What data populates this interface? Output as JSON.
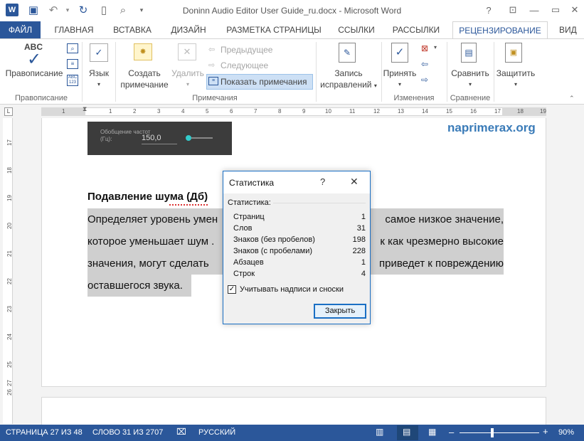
{
  "window": {
    "title": "Doninn Audio Editor User Guide_ru.docx - Microsoft Word",
    "help": "?"
  },
  "tabs": [
    "ФАЙЛ",
    "ГЛАВНАЯ",
    "ВСТАВКА",
    "ДИЗАЙН",
    "РАЗМЕТКА СТРАНИЦЫ",
    "ССЫЛКИ",
    "РАССЫЛКИ",
    "РЕЦЕНЗИРОВАНИЕ",
    "ВИД"
  ],
  "ribbon": {
    "spelling": "Правописание",
    "language": "Язык",
    "new_comment_1": "Создать",
    "new_comment_2": "примечание",
    "delete": "Удалить",
    "prev": "Предыдущее",
    "next": "Следующее",
    "show_comments": "Показать примечания",
    "track_1": "Запись",
    "track_2": "исправлений",
    "accept": "Принять",
    "compare": "Сравнить",
    "protect": "Защитить",
    "groups": {
      "proofing": "Правописание",
      "comments": "Примечания",
      "changes": "Изменения",
      "compare": "Сравнение"
    }
  },
  "ruler": {
    "h": [
      "1",
      "1",
      "2",
      "3",
      "4",
      "5",
      "6",
      "7",
      "8",
      "9",
      "10",
      "11",
      "12",
      "13",
      "14",
      "15",
      "16",
      "17",
      "18",
      "19"
    ],
    "v": [
      "17",
      "18",
      "19",
      "20",
      "21",
      "22",
      "23",
      "24",
      "25",
      "26",
      "27"
    ]
  },
  "document": {
    "screenshot_label": "Обобщение частот (Гц):",
    "screenshot_value": "150,0",
    "heading": "Подавление шума (Дб)",
    "lines": [
      "Определяет уровень уменьшения шума — самое низкое значение,",
      "которое уменьшает шум должным образом, так как чрезмерно высокие",
      "значения, могут сделать звук хуже, что приведет к повреждению",
      "оставшегося звука."
    ],
    "visible_lines": [
      "Определяет уровень умен",
      "которое уменьшает шум .",
      "значения, могут сделать",
      "оставшегося звука."
    ],
    "visible_right": [
      "самое низкое значение,",
      "к как чрезмерно высокие",
      "приведет к повреждению"
    ],
    "watermark": "naprimerax.org"
  },
  "dialog": {
    "title": "Статистика",
    "help": "?",
    "section": "Статистика:",
    "rows": [
      {
        "label": "Страниц",
        "value": "1"
      },
      {
        "label": "Слов",
        "value": "31"
      },
      {
        "label": "Знаков (без пробелов)",
        "value": "198"
      },
      {
        "label": "Знаков (с пробелами)",
        "value": "228"
      },
      {
        "label": "Абзацев",
        "value": "1"
      },
      {
        "label": "Строк",
        "value": "4"
      }
    ],
    "checkbox": "Учитывать надписи и сноски",
    "close": "Закрыть"
  },
  "status": {
    "page": "СТРАНИЦА 27 ИЗ 48",
    "words": "СЛОВО 31 ИЗ 2707",
    "lang": "РУССКИЙ",
    "zoom": "90%"
  },
  "colors": {
    "brand": "#2b579a",
    "accent": "#1a6fc4"
  }
}
